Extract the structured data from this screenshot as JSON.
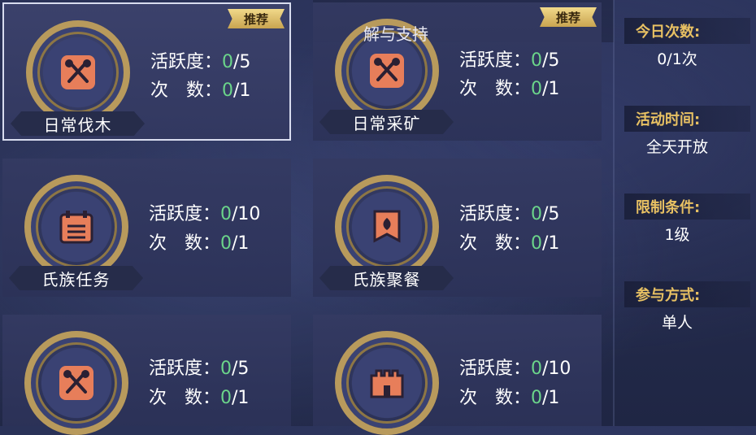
{
  "tooltip_text": "解与支持",
  "recommend_label": "推荐",
  "activities": [
    {
      "name": "日常伐木",
      "activity_label": "活跃度：",
      "activity_cur": "0",
      "activity_max": "/5",
      "count_label": "次　数：",
      "count_cur": "0",
      "count_max": "/1",
      "icon": "crossed-axes-icon",
      "recommended": true,
      "selected": true
    },
    {
      "name": "日常采矿",
      "activity_label": "活跃度：",
      "activity_cur": "0",
      "activity_max": "/5",
      "count_label": "次　数：",
      "count_cur": "0",
      "count_max": "/1",
      "icon": "crossed-picks-icon",
      "recommended": true,
      "selected": false
    },
    {
      "name": "氏族任务",
      "activity_label": "活跃度：",
      "activity_cur": "0",
      "activity_max": "/10",
      "count_label": "次　数：",
      "count_cur": "0",
      "count_max": "/1",
      "icon": "calendar-icon",
      "recommended": false,
      "selected": false
    },
    {
      "name": "氏族聚餐",
      "activity_label": "活跃度：",
      "activity_cur": "0",
      "activity_max": "/5",
      "count_label": "次　数：",
      "count_cur": "0",
      "count_max": "/1",
      "icon": "banner-icon",
      "recommended": false,
      "selected": false
    },
    {
      "name": "",
      "activity_label": "活跃度：",
      "activity_cur": "0",
      "activity_max": "/5",
      "count_label": "次　数：",
      "count_cur": "0",
      "count_max": "/1",
      "icon": "crossed-axes-icon",
      "recommended": false,
      "selected": false
    },
    {
      "name": "",
      "activity_label": "活跃度：",
      "activity_cur": "0",
      "activity_max": "/10",
      "count_label": "次　数：",
      "count_cur": "0",
      "count_max": "/1",
      "icon": "castle-wall-icon",
      "recommended": false,
      "selected": false
    }
  ],
  "info": {
    "today_label": "今日次数:",
    "today_value": "0/1次",
    "time_label": "活动时间:",
    "time_value": "全天开放",
    "limit_label": "限制条件:",
    "limit_value": "1级",
    "mode_label": "参与方式:",
    "mode_value": "单人"
  },
  "colors": {
    "accent_green": "#6bd58a",
    "gold": "#e8c163",
    "icon_orange": "#e77e5a"
  }
}
